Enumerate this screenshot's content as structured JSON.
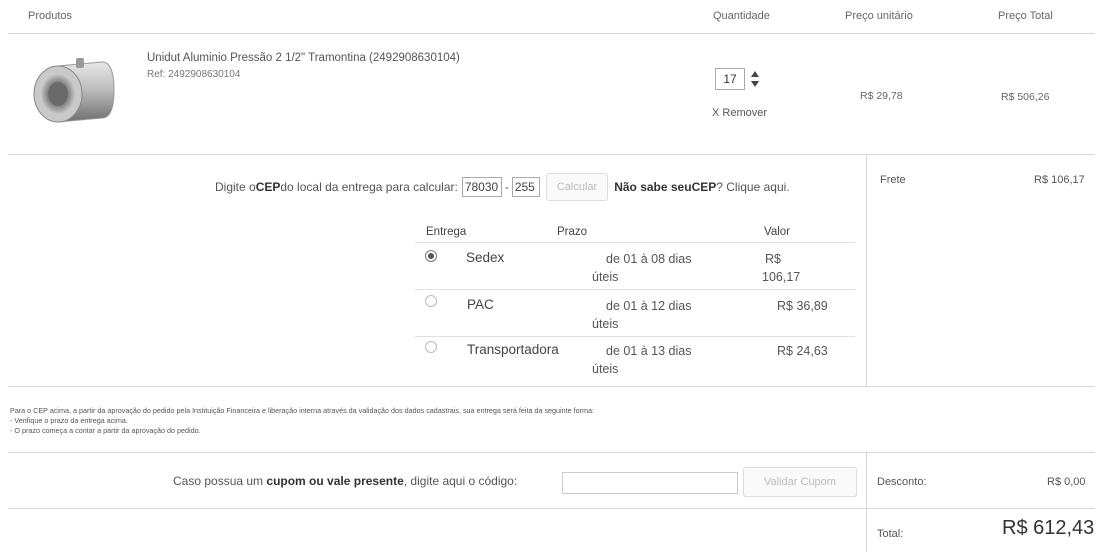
{
  "header": {
    "produtos": "Produtos",
    "quantidade": "Quantidade",
    "preco_unitario": "Preço unitário",
    "preco_total": "Preço Total"
  },
  "product": {
    "name": "Unidut Aluminio Pressão 2 1/2\" Tramontina (2492908630104)",
    "ref": "Ref: 2492908630104",
    "quantity": "17",
    "remove_label": "X Remover",
    "unit_price": "R$ 29,78",
    "total_price": "R$ 506,26"
  },
  "cep": {
    "prompt_prefix": "Digite o ",
    "prompt_bold": "CEP",
    "prompt_suffix": " do local da entrega para calcular:",
    "part1": "78030",
    "dash": "-",
    "part2": "255",
    "button": "Calcular",
    "help_bold1": "Não sabe seu ",
    "help_bold2": "CEP",
    "help_rest": "? Clique aqui."
  },
  "frete": {
    "label": "Frete",
    "value": "R$ 106,17"
  },
  "shipping": {
    "headers": {
      "entrega": "Entrega",
      "prazo": "Prazo",
      "valor": "Valor"
    },
    "options": [
      {
        "name": "Sedex",
        "prazo_l1": "de 01 à 08 dias",
        "prazo_l2": "úteis",
        "valor_l1": "R$",
        "valor_l2": "106,17",
        "selected": true
      },
      {
        "name": "PAC",
        "prazo_l1": "de 01 à 12 dias",
        "prazo_l2": "úteis",
        "valor_l1": "R$ 36,89",
        "valor_l2": "",
        "selected": false
      },
      {
        "name": "Transportadora",
        "prazo_l1": "de 01 à 13 dias",
        "prazo_l2": "úteis",
        "valor_l1": "R$ 24,63",
        "valor_l2": "",
        "selected": false
      }
    ]
  },
  "info": {
    "line1": "Para o CEP acima, a partir da aprovação do pedido pela Instituição Financeira e liberação interna através da validação dos dados cadastrais, sua entrega será feita da seguinte forma:",
    "line2": "- Verifique o prazo da entrega acima.",
    "line3": "- O prazo começa a contar a partir da aprovação do pedido."
  },
  "coupon": {
    "text_prefix": "Caso possua um ",
    "text_bold": "cupom ou vale presente",
    "text_suffix": ", digite aqui o código:",
    "input_value": "",
    "button": "Validar Cupom"
  },
  "summary": {
    "desconto_label": "Desconto:",
    "desconto_value": "R$ 0,00",
    "total_label": "Total:",
    "total_value": "R$ 612,43"
  }
}
